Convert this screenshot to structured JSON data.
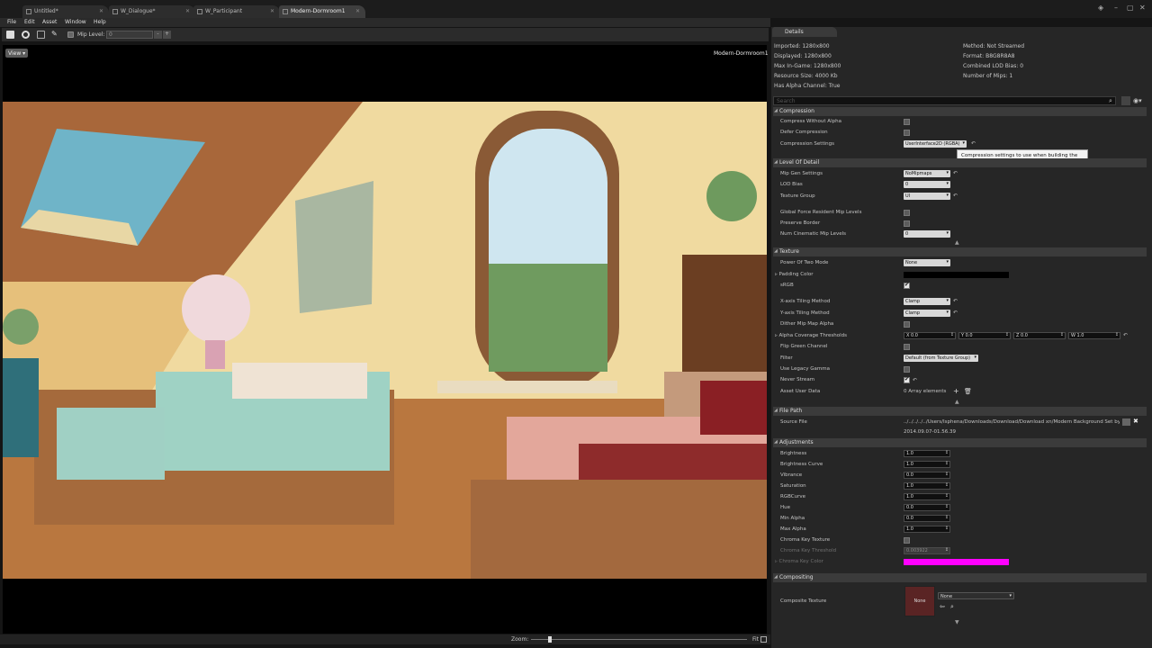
{
  "tabs": [
    {
      "label": "Untitled*"
    },
    {
      "label": "W_Dialogue*"
    },
    {
      "label": "W_Participant"
    },
    {
      "label": "Modern-Dormroom1"
    }
  ],
  "menu": [
    "File",
    "Edit",
    "Asset",
    "Window",
    "Help"
  ],
  "toolbar": {
    "mip_label": "Mip Level:",
    "mip_value": "0"
  },
  "viewport": {
    "view_button": "View ▾",
    "asset_name": "Modern-Dormroom1",
    "zoom_label": "Zoom:",
    "zoom_fit": "Fit",
    "zoom_level": 0.02
  },
  "details": {
    "tab_label": "Details",
    "info_left": [
      "Imported: 1280x800",
      "Displayed: 1280x800",
      "Max In-Game: 1280x800",
      "Resource Size: 4000 Kb",
      "Has Alpha Channel: True"
    ],
    "info_right": [
      "Method: Not Streamed",
      "Format: B8G8R8A8",
      "Combined LOD Bias: 0",
      "Number of Mips: 1"
    ],
    "search_placeholder": "Search",
    "tooltip": "Compression settings to use when building the texture.",
    "compression": {
      "title": "Compression",
      "compress_without_alpha": "Compress Without Alpha",
      "defer_compression": "Defer Compression",
      "compression_settings": "Compression Settings",
      "compression_settings_value": "UserInterface2D (RGBA)"
    },
    "lod": {
      "title": "Level Of Detail",
      "mip_gen": "Mip Gen Settings",
      "mip_gen_value": "NoMipmaps",
      "lod_bias": "LOD Bias",
      "lod_bias_value": "0",
      "texture_group": "Texture Group",
      "texture_group_value": "UI",
      "global_force": "Global Force Resident Mip Levels",
      "preserve_border": "Preserve Border",
      "num_cinematic": "Num Cinematic Mip Levels",
      "num_cinematic_value": "0"
    },
    "texture": {
      "title": "Texture",
      "power_of_two": "Power Of Two Mode",
      "power_of_two_value": "None",
      "padding_color": "Padding Color",
      "srgb": "sRGB",
      "x_tiling": "X-axis Tiling Method",
      "x_tiling_value": "Clamp",
      "y_tiling": "Y-axis Tiling Method",
      "y_tiling_value": "Clamp",
      "dither": "Dither Mip Map Alpha",
      "alpha_coverage": "Alpha Coverage Thresholds",
      "alpha_x": "X  0.0",
      "alpha_y": "Y  0.0",
      "alpha_z": "Z  0.0",
      "alpha_w": "W  1.0",
      "flip_green": "Flip Green Channel",
      "filter": "Filter",
      "filter_value": "Default (from Texture Group)",
      "legacy_gamma": "Use Legacy Gamma",
      "never_stream": "Never Stream",
      "asset_user_data": "Asset User Data",
      "asset_user_data_value": "0 Array elements"
    },
    "filepath": {
      "title": "File Path",
      "source_file": "Source File",
      "source_value": "../../../../../Users/Isphena/Downloads/Download/Download xn/Modern Background Set by Kae",
      "timestamp": "2014.09.07-01.56.39"
    },
    "adjustments": {
      "title": "Adjustments",
      "rows": [
        {
          "label": "Brightness",
          "value": "1.0"
        },
        {
          "label": "Brightness Curve",
          "value": "1.0"
        },
        {
          "label": "Vibrance",
          "value": "0.0"
        },
        {
          "label": "Saturation",
          "value": "1.0"
        },
        {
          "label": "RGBCurve",
          "value": "1.0"
        },
        {
          "label": "Hue",
          "value": "0.0"
        },
        {
          "label": "Min Alpha",
          "value": "0.0"
        },
        {
          "label": "Max Alpha",
          "value": "1.0"
        }
      ],
      "chroma_key_texture": "Chroma Key Texture",
      "chroma_key_threshold": "Chroma Key Threshold",
      "chroma_key_threshold_value": "0.003922",
      "chroma_key_color": "Chroma Key Color"
    },
    "compositing": {
      "title": "Compositing",
      "composite_texture": "Composite Texture",
      "thumb_label": "None",
      "composite_value": "None"
    }
  },
  "colors": {
    "padding": "#000000",
    "chroma": "#ff00ff",
    "accent": "#e6cc8f"
  }
}
